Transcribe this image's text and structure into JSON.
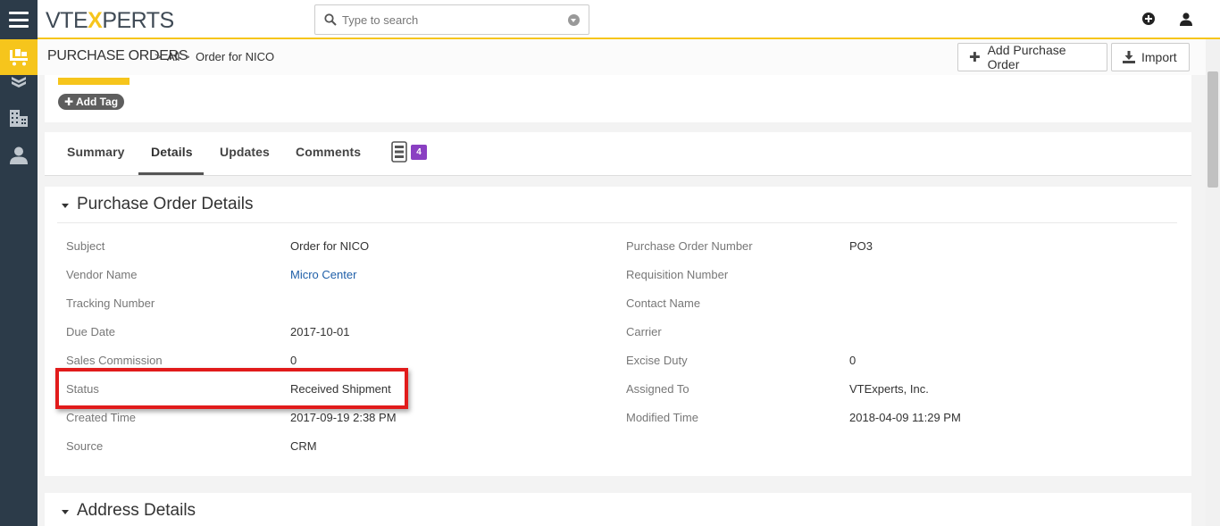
{
  "brand": {
    "logo_pre": "VTE",
    "logo_x": "X",
    "logo_post": "PERTS"
  },
  "search": {
    "placeholder": "Type to search"
  },
  "breadcrumb": {
    "module": "PURCHASE ORDERS",
    "filter": "All",
    "record": "Order for NICO",
    "separator": ">"
  },
  "header_buttons": {
    "add": "Add Purchase Order",
    "import": "Import"
  },
  "tags": {
    "add_tag_label": "Add Tag"
  },
  "tabs": [
    {
      "label": "Summary"
    },
    {
      "label": "Details"
    },
    {
      "label": "Updates"
    },
    {
      "label": "Comments"
    }
  ],
  "active_tab": "Details",
  "related_count": "4",
  "section": {
    "title": "Purchase Order Details",
    "left_fields": [
      {
        "label": "Subject",
        "value": "Order for NICO"
      },
      {
        "label": "Vendor Name",
        "value": "Micro Center"
      },
      {
        "label": "Tracking Number",
        "value": ""
      },
      {
        "label": "Due Date",
        "value": "2017-10-01"
      },
      {
        "label": "Sales Commission",
        "value": "0"
      },
      {
        "label": "Status",
        "value": "Received Shipment"
      },
      {
        "label": "Created Time",
        "value": "2017-09-19 2:38 PM"
      },
      {
        "label": "Source",
        "value": "CRM"
      }
    ],
    "right_fields": [
      {
        "label": "Purchase Order Number",
        "value": "PO3"
      },
      {
        "label": "Requisition Number",
        "value": ""
      },
      {
        "label": "Contact Name",
        "value": ""
      },
      {
        "label": "Carrier",
        "value": ""
      },
      {
        "label": "Excise Duty",
        "value": "0"
      },
      {
        "label": "Assigned To",
        "value": "VTExperts, Inc."
      },
      {
        "label": "Modified Time",
        "value": "2018-04-09 11:29 PM"
      }
    ]
  },
  "address_section": {
    "title": "Address Details"
  },
  "colors": {
    "accent": "#f6c51c",
    "sidebar": "#2c3b49",
    "link": "#1f5fa8",
    "highlight": "#e11b1b",
    "badge": "#8a3fc2"
  }
}
